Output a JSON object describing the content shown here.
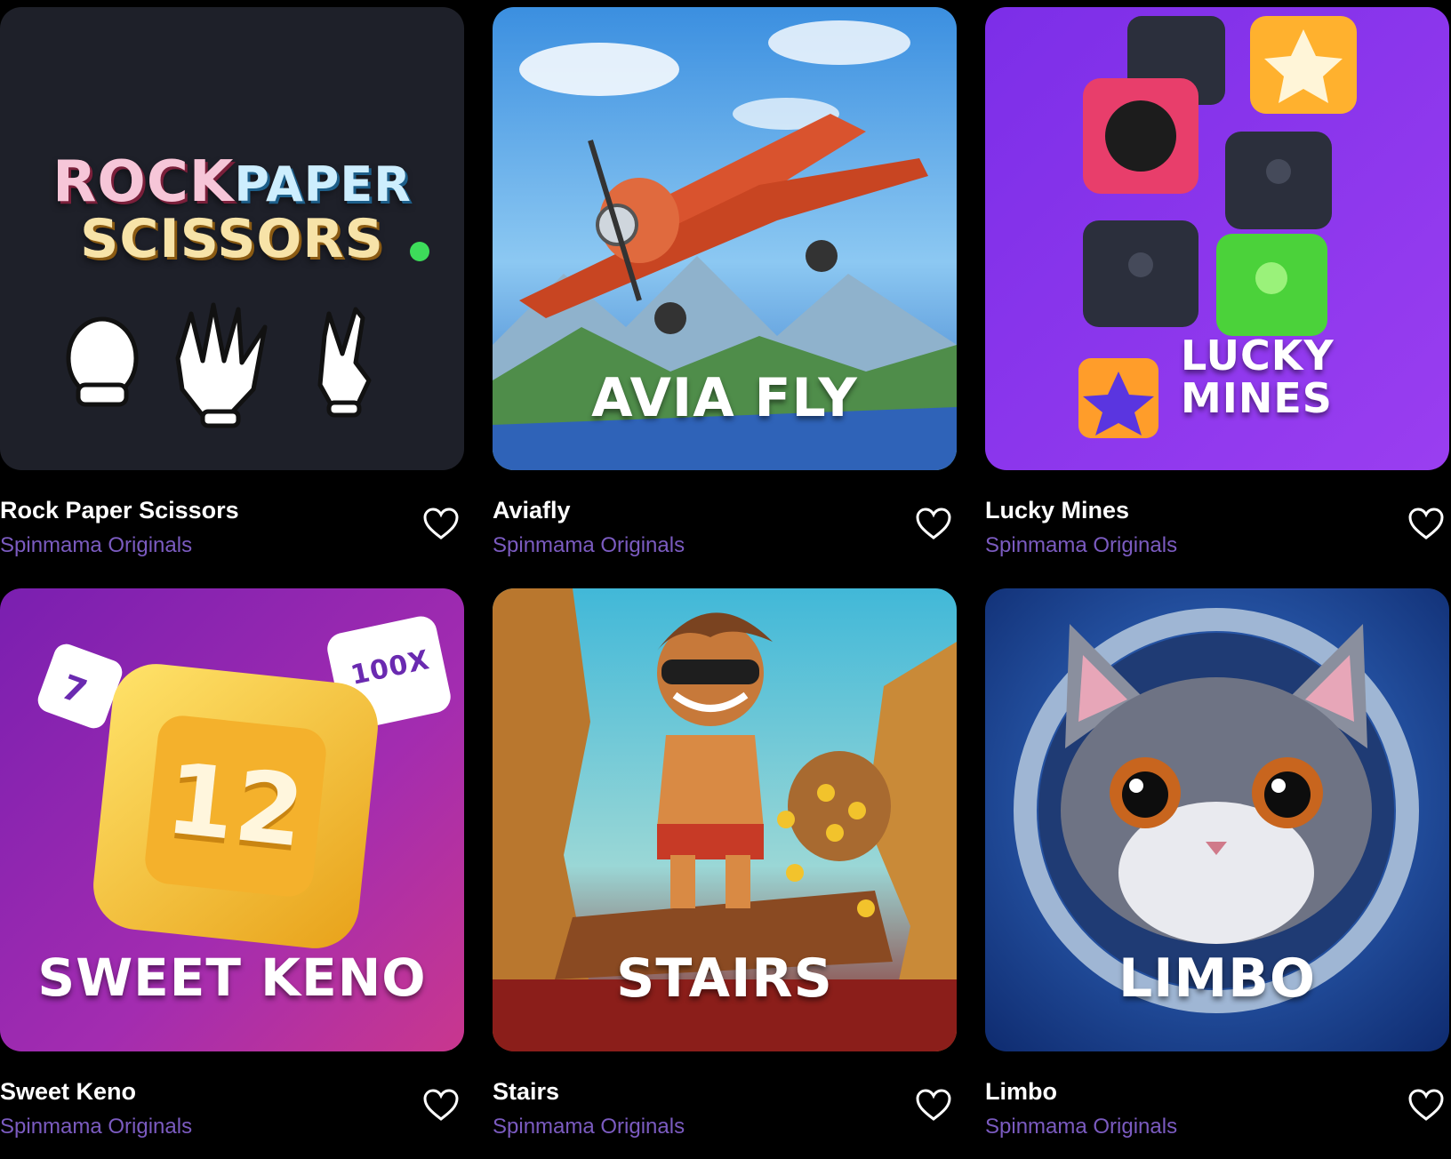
{
  "games": [
    {
      "title": "Rock Paper Scissors",
      "provider": "Spinmama Originals",
      "logo": {
        "line1a": "ROCK",
        "line1b": "PAPER",
        "line2": "SCISSORS"
      },
      "art": "rock-paper-scissors-hands"
    },
    {
      "title": "Aviafly",
      "provider": "Spinmama Originals",
      "logo": {
        "text": "AVIA FLY"
      },
      "art": "red-propeller-plane"
    },
    {
      "title": "Lucky Mines",
      "provider": "Spinmama Originals",
      "logo": {
        "line1": "LUCKY",
        "line2": "MINES"
      },
      "art": "mine-tiles-bomb-star"
    },
    {
      "title": "Sweet Keno",
      "provider": "Spinmama Originals",
      "logo": {
        "text": "SWEET KENO",
        "number": "12",
        "dice_small": "7",
        "dice_large": "100X"
      },
      "art": "gold-keno-tile"
    },
    {
      "title": "Stairs",
      "provider": "Spinmama Originals",
      "logo": {
        "text": "STAIRS"
      },
      "art": "adventurer-with-coin-bag"
    },
    {
      "title": "Limbo",
      "provider": "Spinmama Originals",
      "logo": {
        "text": "LIMBO"
      },
      "art": "astronaut-cat"
    }
  ],
  "icons": {
    "favorite": "heart-outline-icon"
  },
  "colors": {
    "background": "#000000",
    "provider": "#7b5bc0",
    "title": "#ffffff"
  }
}
